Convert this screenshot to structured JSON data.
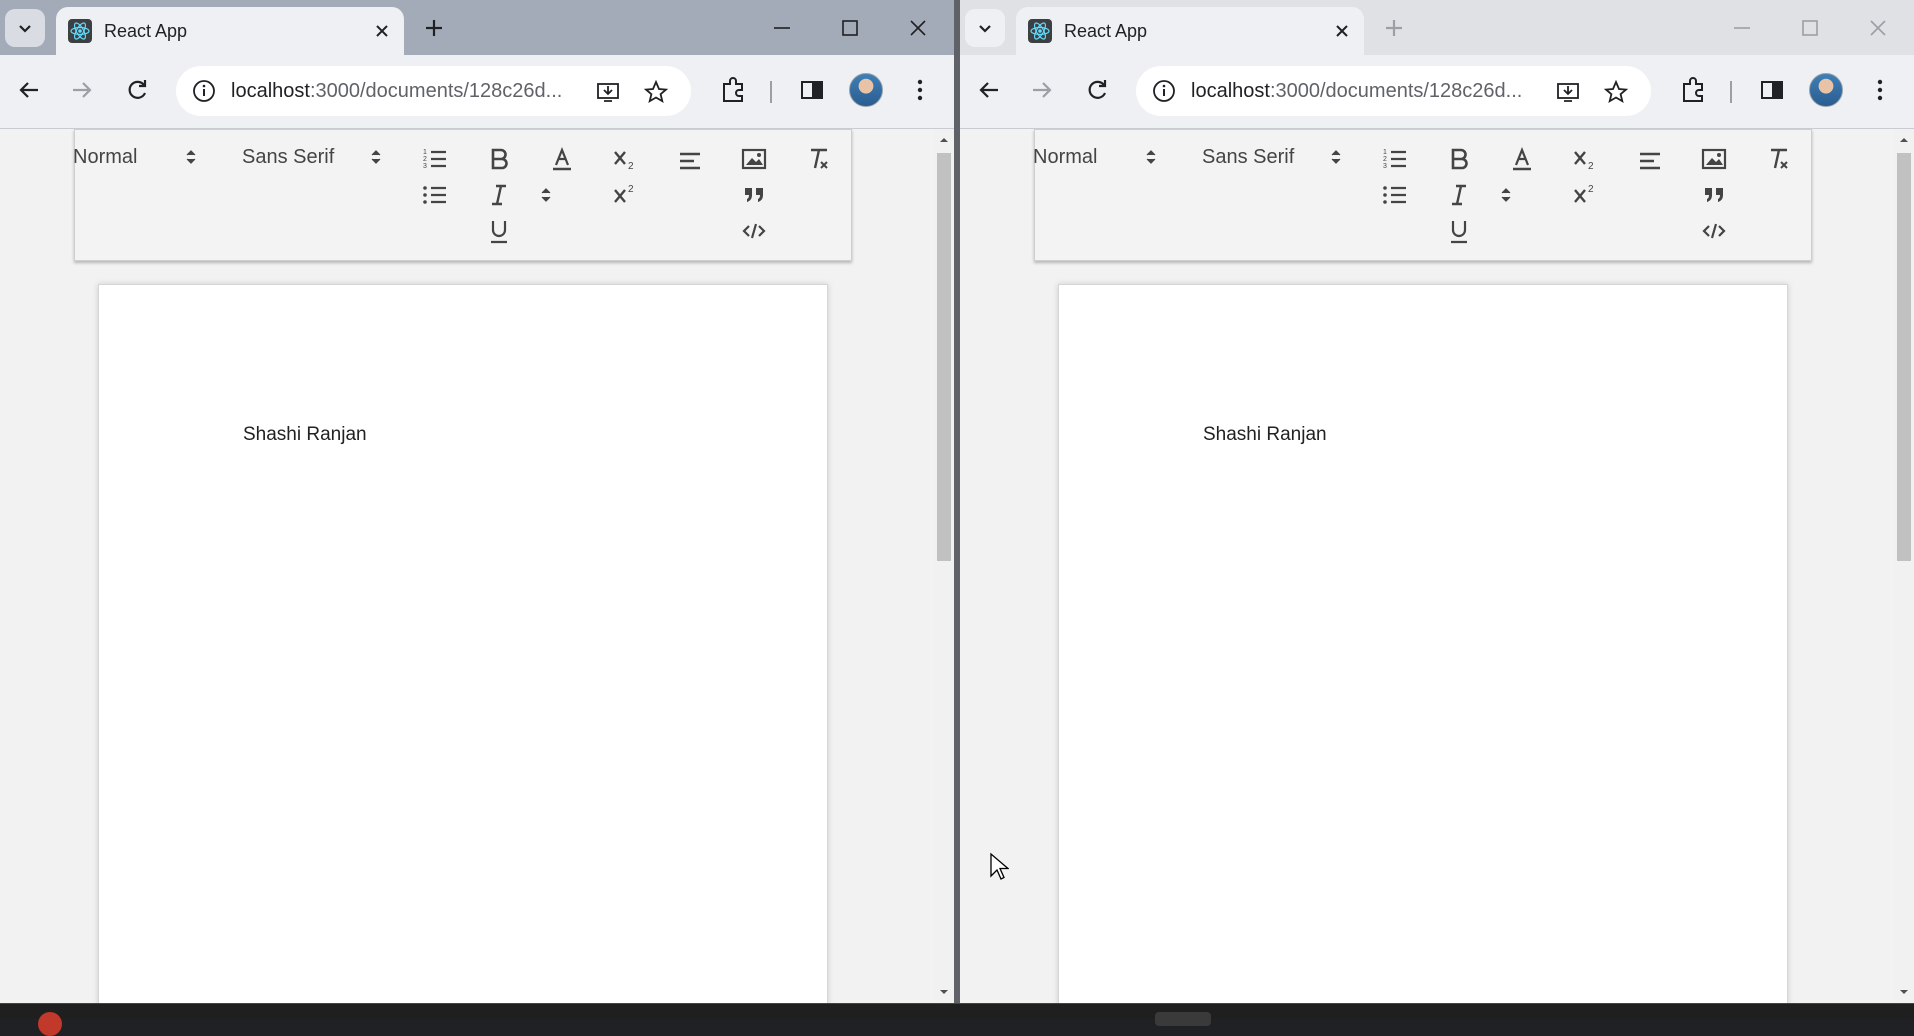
{
  "windows": [
    {
      "id": "left",
      "tab_title": "React App",
      "url_host": "localhost",
      "url_path": ":3000/documents/128c26d...",
      "toolbar": {
        "header_picker": "Normal",
        "font_picker": "Sans Serif"
      },
      "document_text": "Shashi Ranjan"
    },
    {
      "id": "right",
      "tab_title": "React App",
      "url_host": "localhost",
      "url_path": ":3000/documents/128c26d...",
      "toolbar": {
        "header_picker": "Normal",
        "font_picker": "Sans Serif"
      },
      "document_text": "Shashi Ranjan"
    }
  ],
  "icons": {
    "tab_search": "chevron-down-icon",
    "favicon": "react-icon",
    "close": "close-icon",
    "new_tab": "plus-icon",
    "back": "arrow-left-icon",
    "forward": "arrow-right-icon",
    "reload": "reload-icon",
    "site_info": "info-icon",
    "install": "install-app-icon",
    "bookmark": "star-icon",
    "extensions": "puzzle-icon",
    "side_panel": "side-panel-icon",
    "menu": "kebab-menu-icon",
    "ordered_list": "ordered-list-icon",
    "bullet_list": "bullet-list-icon",
    "bold": "bold-icon",
    "italic": "italic-icon",
    "underline": "underline-icon",
    "color": "text-color-icon",
    "subscript": "subscript-icon",
    "superscript": "superscript-icon",
    "align": "align-icon",
    "image": "image-icon",
    "blockquote": "blockquote-icon",
    "code": "code-block-icon",
    "clean": "clear-formatting-icon"
  },
  "colors": {
    "active_tabstrip": "#a4abb8",
    "inactive_tabstrip": "#dfe1e5",
    "page_bg": "#f2f2f2",
    "document_bg": "#ffffff"
  }
}
